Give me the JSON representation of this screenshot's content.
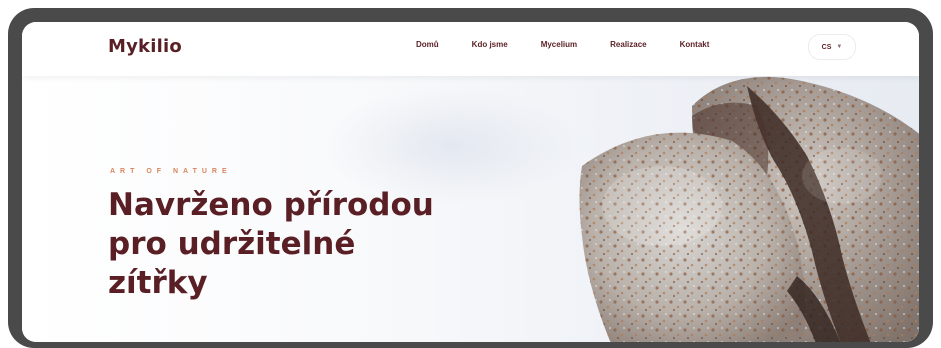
{
  "brand": {
    "name": "Mykilio",
    "color": "#5a1f24",
    "accent": "#d8845a"
  },
  "nav": {
    "items": [
      {
        "label": "Domů"
      },
      {
        "label": "Kdo jsme"
      },
      {
        "label": "Mycelium"
      },
      {
        "label": "Realizace"
      },
      {
        "label": "Kontakt"
      }
    ],
    "language": {
      "value": "CS",
      "icon": "chevron-down-icon"
    }
  },
  "hero": {
    "eyebrow": "ART OF NATURE",
    "headline_lines": [
      "Navrženo přírodou",
      "pro udržitelné",
      "zítřky"
    ],
    "image": "mycelium-material-closeup"
  }
}
